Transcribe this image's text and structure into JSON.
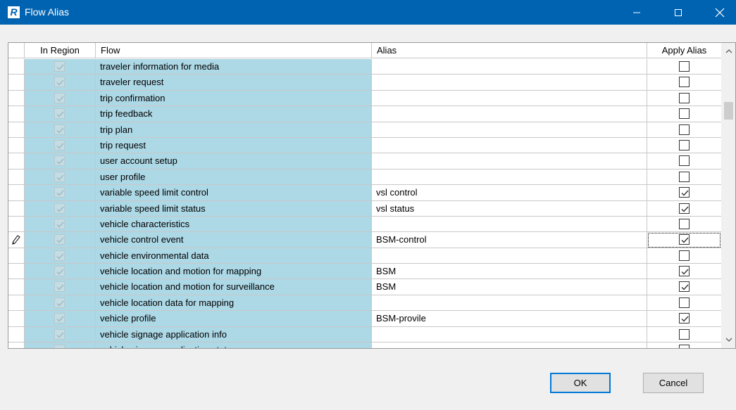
{
  "window": {
    "title": "Flow Alias",
    "app_icon_letter": "R"
  },
  "grid": {
    "columns": {
      "in_region": "In Region",
      "flow": "Flow",
      "alias": "Alias",
      "apply_alias": "Apply Alias"
    },
    "rows": [
      {
        "flow": "traveler information for media",
        "alias": "",
        "in_region": true,
        "apply": false
      },
      {
        "flow": "traveler request",
        "alias": "",
        "in_region": true,
        "apply": false
      },
      {
        "flow": "trip confirmation",
        "alias": "",
        "in_region": true,
        "apply": false
      },
      {
        "flow": "trip feedback",
        "alias": "",
        "in_region": true,
        "apply": false
      },
      {
        "flow": "trip plan",
        "alias": "",
        "in_region": true,
        "apply": false
      },
      {
        "flow": "trip request",
        "alias": "",
        "in_region": true,
        "apply": false
      },
      {
        "flow": "user account setup",
        "alias": "",
        "in_region": true,
        "apply": false
      },
      {
        "flow": "user profile",
        "alias": "",
        "in_region": true,
        "apply": false
      },
      {
        "flow": "variable speed limit control",
        "alias": "vsl control",
        "in_region": true,
        "apply": true
      },
      {
        "flow": "variable speed limit status",
        "alias": "vsl status",
        "in_region": true,
        "apply": true
      },
      {
        "flow": "vehicle characteristics",
        "alias": "",
        "in_region": true,
        "apply": false
      },
      {
        "flow": "vehicle control event",
        "alias": "BSM-control",
        "in_region": true,
        "apply": true,
        "current": true
      },
      {
        "flow": "vehicle environmental data",
        "alias": "",
        "in_region": true,
        "apply": false
      },
      {
        "flow": "vehicle location and motion for mapping",
        "alias": "BSM",
        "in_region": true,
        "apply": true
      },
      {
        "flow": "vehicle location and motion for surveillance",
        "alias": "BSM",
        "in_region": true,
        "apply": true
      },
      {
        "flow": "vehicle location data for mapping",
        "alias": "",
        "in_region": true,
        "apply": false
      },
      {
        "flow": "vehicle profile",
        "alias": "BSM-provile",
        "in_region": true,
        "apply": true
      },
      {
        "flow": "vehicle signage application info",
        "alias": "",
        "in_region": true,
        "apply": false
      },
      {
        "flow": "vehicle signage application status",
        "alias": "",
        "in_region": true,
        "apply": false
      }
    ]
  },
  "buttons": {
    "ok": "OK",
    "cancel": "Cancel"
  },
  "icons": {
    "app": "app-r-icon",
    "minimize": "minimize-icon",
    "maximize": "maximize-icon",
    "close": "close-icon",
    "edit_row": "pencil-icon"
  },
  "colors": {
    "titlebar": "#0063b1",
    "row_highlight": "#add8e6",
    "ok_border": "#0078d7"
  }
}
